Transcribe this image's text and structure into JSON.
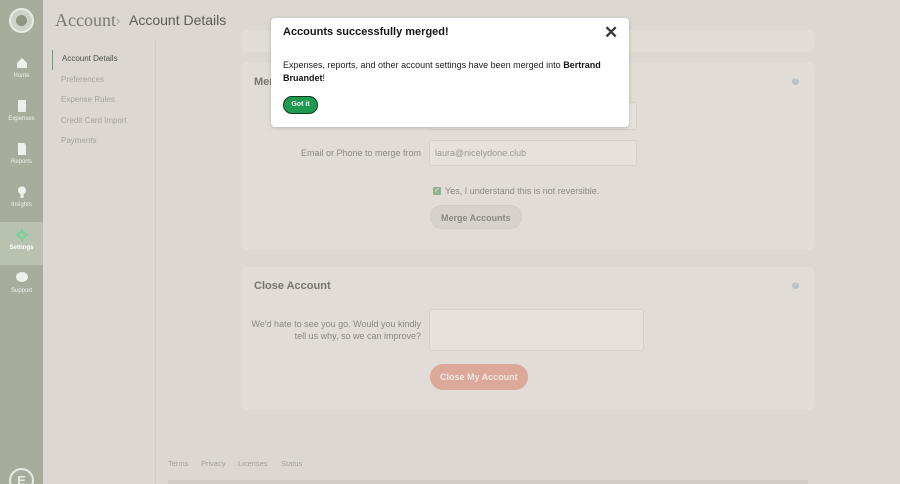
{
  "nav": {
    "items": [
      {
        "label": "Home",
        "icon": "home-icon"
      },
      {
        "label": "Expenses",
        "icon": "receipt-icon"
      },
      {
        "label": "Reports",
        "icon": "document-icon"
      },
      {
        "label": "Insights",
        "icon": "lightbulb-icon"
      },
      {
        "label": "Settings",
        "icon": "gear-icon",
        "active": true
      },
      {
        "label": "Support",
        "icon": "chat-icon"
      }
    ],
    "bottom_logo": "E"
  },
  "header": {
    "breadcrumb_root": "Account",
    "separator": "›",
    "title": "Account Details"
  },
  "subnav": {
    "items": [
      {
        "label": "Account Details",
        "active": true
      },
      {
        "label": "Preferences"
      },
      {
        "label": "Expense Rules"
      },
      {
        "label": "Credit Card Import"
      },
      {
        "label": "Payments"
      }
    ]
  },
  "merge_card": {
    "title_partial": "Mer",
    "help_icon": "?",
    "email_label": "Email or Phone to merge from",
    "email_value": "laura@nicelydone.club",
    "confirm_checked": true,
    "confirm_label": "Yes, I understand this is not reversible.",
    "merge_button": "Merge Accounts"
  },
  "close_card": {
    "title": "Close Account",
    "help_icon": "?",
    "reason_label_line1": "We'd hate to see you go. Would you kindly",
    "reason_label_line2": "tell us why, so we can improve?",
    "reason_value": "",
    "close_button": "Close My Account"
  },
  "footer": {
    "links": [
      "Terms",
      "Privacy",
      "Licenses",
      "Status"
    ]
  },
  "modal": {
    "title": "Accounts successfully merged!",
    "body_text": "Expenses, reports, and other account settings have been merged into ",
    "body_name": "Bertrand Bruandet",
    "body_end": "!",
    "button": "Got it",
    "close_glyph": "✕"
  },
  "colors": {
    "accent_green": "#1e9a4f",
    "nav_bg": "#a6ad9d",
    "danger_button": "#dba89a"
  }
}
